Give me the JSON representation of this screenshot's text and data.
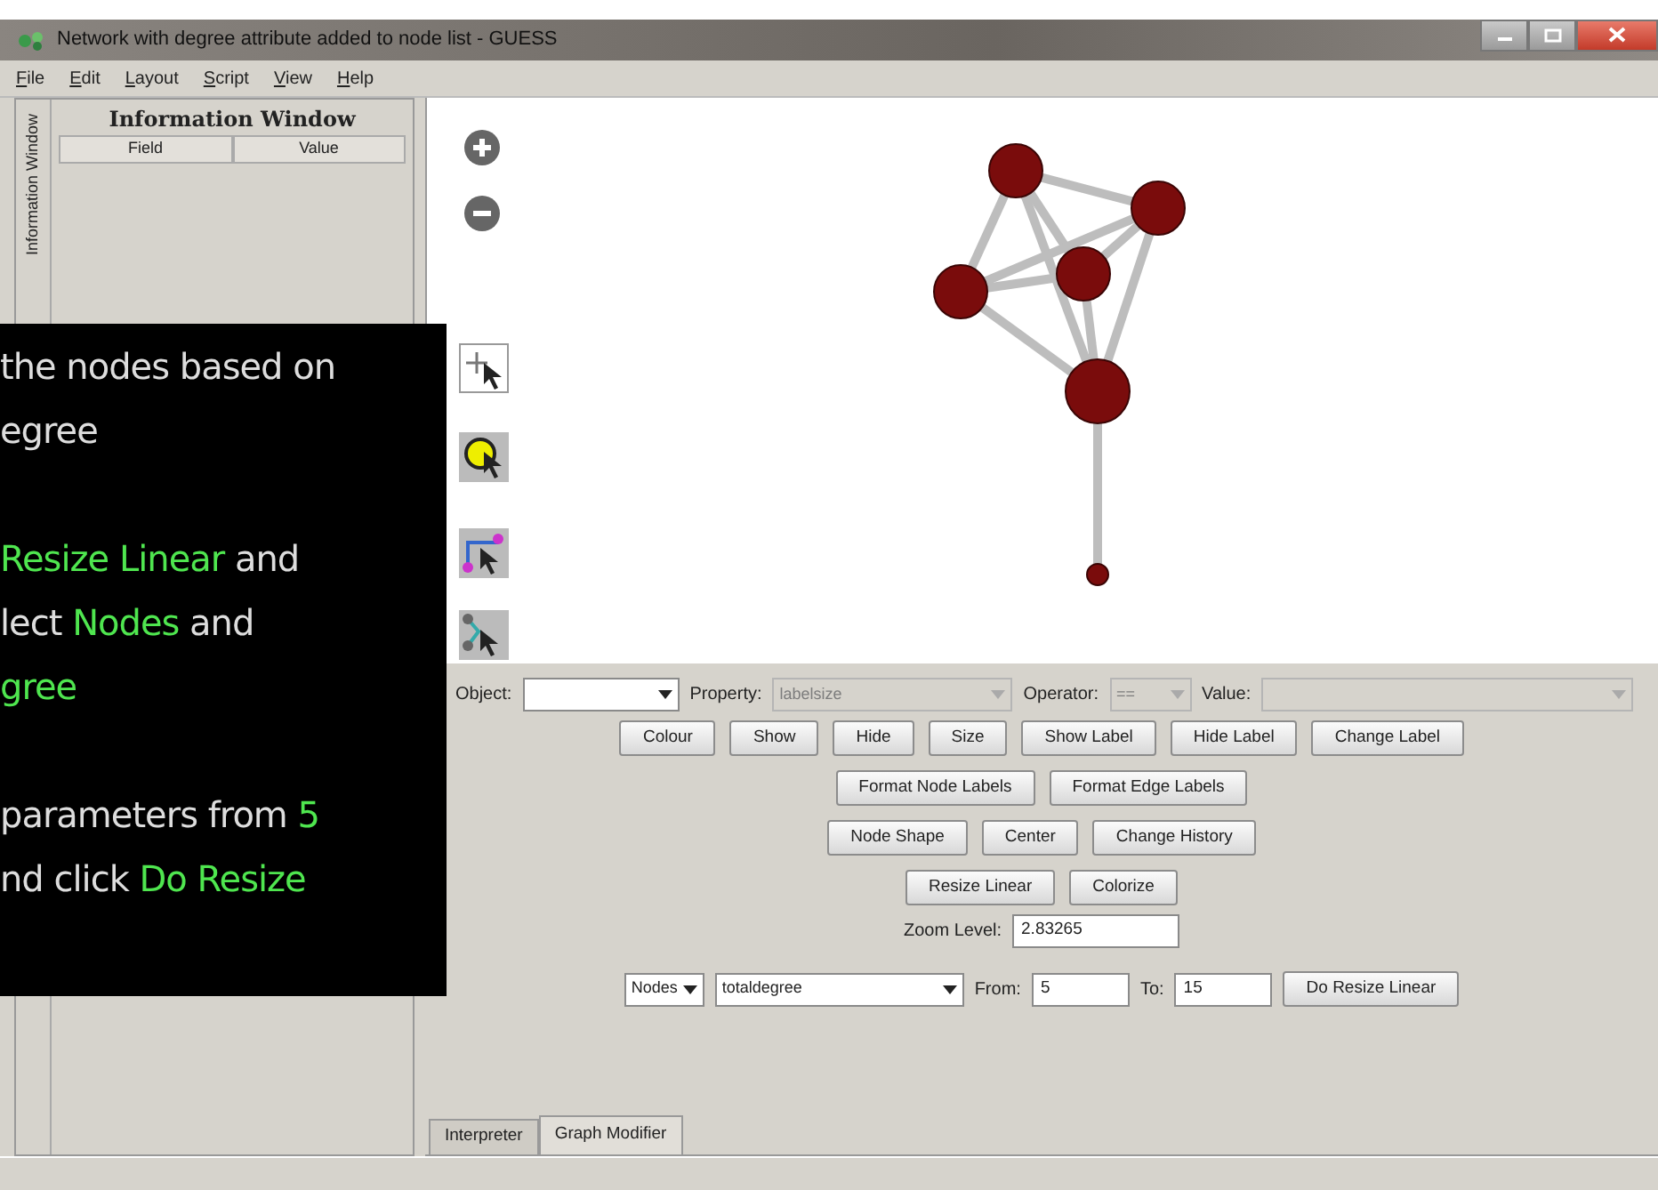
{
  "window": {
    "title": "Network with degree attribute added to node list - GUESS"
  },
  "menu": [
    {
      "key": "F",
      "rest": "ile"
    },
    {
      "key": "E",
      "rest": "dit"
    },
    {
      "key": "L",
      "rest": "ayout"
    },
    {
      "key": "S",
      "rest": "cript"
    },
    {
      "key": "V",
      "rest": "iew"
    },
    {
      "key": "H",
      "rest": "elp"
    }
  ],
  "info_panel": {
    "side_tab": "Information Window",
    "title": "Information Window",
    "columns": [
      "Field",
      "Value"
    ]
  },
  "overlay": {
    "lines": [
      {
        "kind": "text",
        "segments": [
          {
            "text": "the nodes based on",
            "highlight": false
          }
        ]
      },
      {
        "kind": "text",
        "segments": [
          {
            "text": "egree",
            "highlight": false
          }
        ]
      },
      {
        "kind": "blank"
      },
      {
        "kind": "text",
        "segments": [
          {
            "text": "Resize Linear",
            "highlight": true
          },
          {
            "text": " and",
            "highlight": false
          }
        ]
      },
      {
        "kind": "text",
        "segments": [
          {
            "text": "lect ",
            "highlight": false
          },
          {
            "text": "Nodes",
            "highlight": true
          },
          {
            "text": " and",
            "highlight": false
          }
        ]
      },
      {
        "kind": "text",
        "segments": [
          {
            "text": "gree",
            "highlight": true
          }
        ]
      },
      {
        "kind": "blank"
      },
      {
        "kind": "text",
        "segments": [
          {
            "text": " parameters from ",
            "highlight": false
          },
          {
            "text": "5",
            "highlight": true
          }
        ]
      },
      {
        "kind": "text",
        "segments": [
          {
            "text": "nd click ",
            "highlight": false
          },
          {
            "text": "Do Resize",
            "highlight": true
          }
        ]
      }
    ]
  },
  "filter": [
    {
      "label": "Object:",
      "disabled": false
    },
    {
      "label": "Property:",
      "value": "labelsize",
      "disabled": true
    },
    {
      "label": "Operator:",
      "value": "==",
      "disabled": true
    },
    {
      "label": "Value:",
      "disabled": true
    }
  ],
  "button_rows": [
    [
      "Colour",
      "Show",
      "Hide",
      "Size",
      "Show Label",
      "Hide Label",
      "Change Label"
    ],
    [
      "Format Node Labels",
      "Format Edge Labels"
    ],
    [
      "Node Shape",
      "Center",
      "Change History"
    ],
    [
      "Resize Linear",
      "Colorize"
    ]
  ],
  "zoom": {
    "label": "Zoom Level:",
    "value": "2.83265"
  },
  "resize": {
    "object": "Nodes",
    "attribute": "totaldegree",
    "from_label": "From:",
    "from": "5",
    "to_label": "To:",
    "to": "15",
    "button": "Do Resize Linear"
  },
  "tabs": [
    {
      "label": "Interpreter",
      "selected": false
    },
    {
      "label": "Graph Modifier",
      "selected": true
    }
  ]
}
